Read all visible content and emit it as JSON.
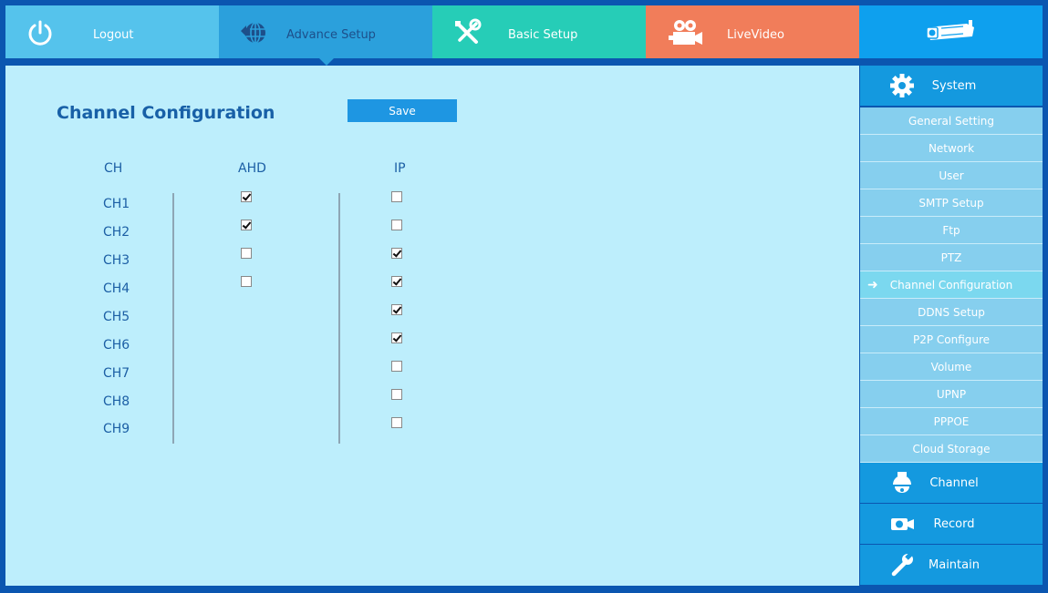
{
  "topnav": {
    "logout": "Logout",
    "advance": "Advance Setup",
    "basic": "Basic Setup",
    "live": "LiveVideo"
  },
  "main": {
    "title": "Channel Configuration",
    "save": "Save",
    "headers": {
      "ch": "CH",
      "ahd": "AHD",
      "ip": "IP"
    },
    "channels": [
      {
        "label": "CH1",
        "ahd": true,
        "ip": false
      },
      {
        "label": "CH2",
        "ahd": true,
        "ip": false
      },
      {
        "label": "CH3",
        "ahd": false,
        "ip": true
      },
      {
        "label": "CH4",
        "ahd": false,
        "ip": true
      },
      {
        "label": "CH5",
        "ahd": null,
        "ip": true
      },
      {
        "label": "CH6",
        "ahd": null,
        "ip": true
      },
      {
        "label": "CH7",
        "ahd": null,
        "ip": false
      },
      {
        "label": "CH8",
        "ahd": null,
        "ip": false
      },
      {
        "label": "CH9",
        "ahd": null,
        "ip": false
      }
    ]
  },
  "sidebar": {
    "system": "System",
    "items": [
      "General Setting",
      "Network",
      "User",
      "SMTP Setup",
      "Ftp",
      "PTZ",
      "Channel Configuration",
      "DDNS Setup",
      "P2P Configure",
      "Volume",
      "UPNP",
      "PPPOE",
      "Cloud Storage"
    ],
    "active_item": "Channel Configuration",
    "channel": "Channel",
    "record": "Record",
    "maintain": "Maintain"
  },
  "icons": {
    "logout": "power-icon",
    "advance": "globe-icon",
    "basic": "tools-icon",
    "live": "video-camera-icon",
    "brand": "bullet-camera-icon",
    "system": "gear-icon",
    "channel": "dome-camera-icon",
    "record": "record-icon",
    "maintain": "wrench-icon"
  }
}
